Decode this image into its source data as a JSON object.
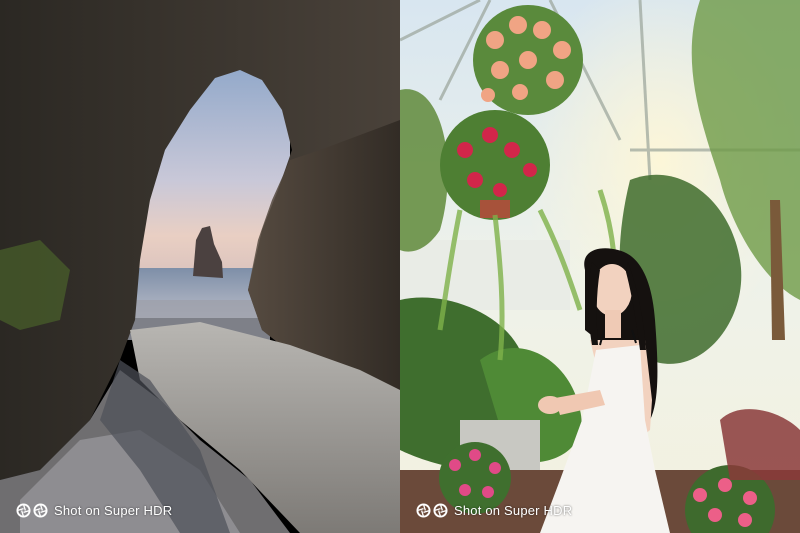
{
  "panels": [
    {
      "id": "sea-arch",
      "watermark": "Shot on Super HDR",
      "logo_icon": "camera-aperture-icon"
    },
    {
      "id": "garden-portrait",
      "watermark": "Shot on Super HDR",
      "logo_icon": "camera-aperture-icon"
    }
  ],
  "colors": {
    "watermark_text": "#ffffff"
  }
}
